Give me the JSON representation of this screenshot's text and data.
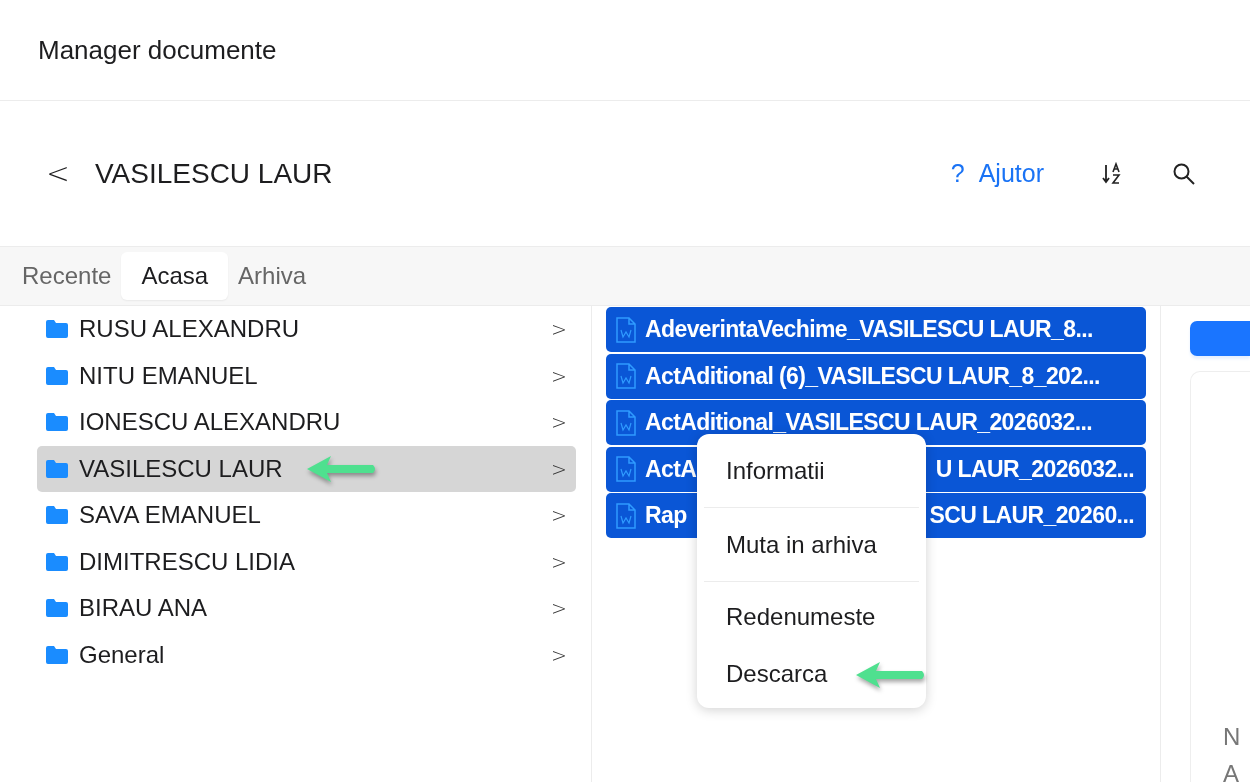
{
  "app": {
    "title": "Manager documente"
  },
  "toolbar": {
    "back": "<",
    "title": "VASILESCU LAUR",
    "help_icon": "?",
    "help": "Ajutor"
  },
  "tabs": [
    {
      "label": "Recente",
      "selected": false
    },
    {
      "label": "Acasa",
      "selected": true
    },
    {
      "label": "Arhiva",
      "selected": false
    }
  ],
  "folders": [
    {
      "name": "RUSU ALEXANDRU",
      "selected": false,
      "chevron": ">"
    },
    {
      "name": "NITU EMANUEL",
      "selected": false,
      "chevron": ">"
    },
    {
      "name": "IONESCU ALEXANDRU",
      "selected": false,
      "chevron": ">"
    },
    {
      "name": "VASILESCU LAUR",
      "selected": true,
      "chevron": ">",
      "annotated": true
    },
    {
      "name": "SAVA EMANUEL",
      "selected": false,
      "chevron": ">"
    },
    {
      "name": "DIMITRESCU LIDIA",
      "selected": false,
      "chevron": ">"
    },
    {
      "name": "BIRAU ANA",
      "selected": false,
      "chevron": ">"
    },
    {
      "name": "General",
      "selected": false,
      "chevron": ">"
    }
  ],
  "files": [
    {
      "name": "AdeverintaVechime_VASILESCU LAUR_8...",
      "selected": true
    },
    {
      "name": "ActAditional (6)_VASILESCU LAUR_8_202...",
      "selected": true
    },
    {
      "name": "ActAditional_VASILESCU LAUR_2026032...",
      "selected": true
    },
    {
      "name": "ActA",
      "name_after_menu": "U LAUR_2026032...",
      "selected": true
    },
    {
      "name": "Rap",
      "name_after_menu": "SCU LAUR_20260...",
      "selected": true
    }
  ],
  "context_menu": {
    "groups": [
      [
        {
          "label": "Informatii"
        }
      ],
      [
        {
          "label": "Muta in arhiva"
        }
      ],
      [
        {
          "label": "Redenumeste"
        },
        {
          "label": "Descarca",
          "annotated": true
        }
      ]
    ]
  },
  "side_panel": {
    "texts": [
      "N",
      "A"
    ]
  }
}
